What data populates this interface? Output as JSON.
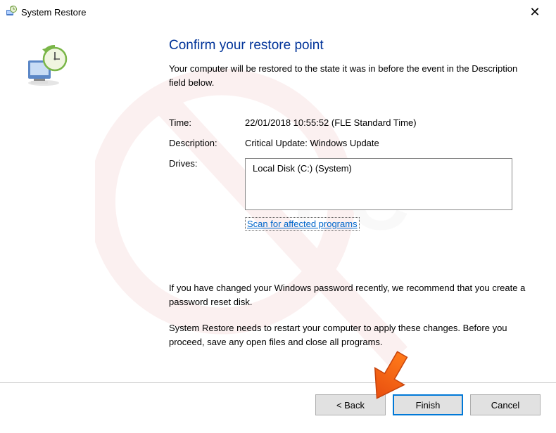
{
  "titlebar": {
    "title": "System Restore"
  },
  "heading": "Confirm your restore point",
  "subheading": "Your computer will be restored to the state it was in before the event in the Description field below.",
  "fields": {
    "time_label": "Time:",
    "time_value": "22/01/2018 10:55:52 (FLE Standard Time)",
    "description_label": "Description:",
    "description_value": "Critical Update: Windows Update",
    "drives_label": "Drives:",
    "drives_value": "Local Disk (C:) (System)"
  },
  "scan_link": "Scan for affected programs",
  "info": {
    "password_note": "If you have changed your Windows password recently, we recommend that you create a password reset disk.",
    "restart_note": "System Restore needs to restart your computer to apply these changes. Before you proceed, save any open files and close all programs."
  },
  "buttons": {
    "back": "< Back",
    "finish": "Finish",
    "cancel": "Cancel"
  }
}
